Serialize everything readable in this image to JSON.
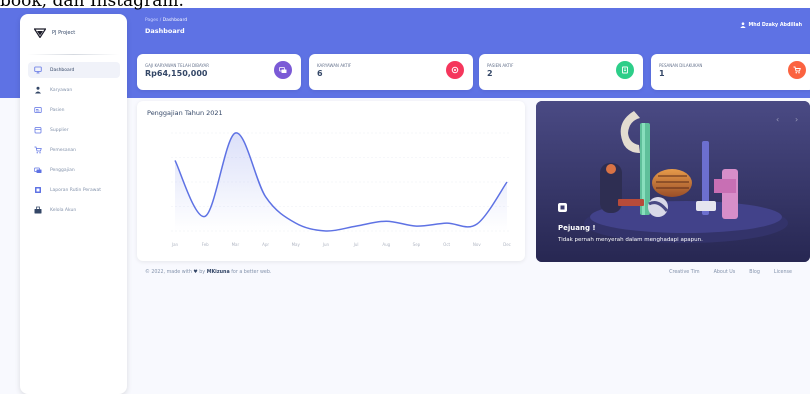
{
  "caption": {
    "text": "book, dan Instagram."
  },
  "sidebar": {
    "brand": "PJ Project",
    "items": [
      {
        "label": "Dashboard",
        "icon": "monitor-icon",
        "color": "#5e72e4",
        "active": true
      },
      {
        "label": "Karyawan",
        "icon": "user-tie-icon",
        "color": "#344767"
      },
      {
        "label": "Pasien",
        "icon": "id-card-icon",
        "color": "#5e72e4"
      },
      {
        "label": "Supplier",
        "icon": "box-icon",
        "color": "#5e72e4"
      },
      {
        "label": "Pemesanan",
        "icon": "cart-icon",
        "color": "#5e72e4"
      },
      {
        "label": "Penggajian",
        "icon": "money-icon",
        "color": "#5e72e4"
      },
      {
        "label": "Laporan Rutin Perawat",
        "icon": "report-icon",
        "color": "#5e72e4"
      },
      {
        "label": "Kelola Akun",
        "icon": "users-icon",
        "color": "#344767"
      }
    ]
  },
  "header": {
    "breadcrumb_root": "Pages",
    "breadcrumb_sep": "/",
    "breadcrumb_current": "Dashboard",
    "title": "Dashboard",
    "user": "Mhd Dzaky Abdillah"
  },
  "stats": [
    {
      "label": "GAJI KARYAWAN TELAH DIBAYAR",
      "value": "Rp64,150,000",
      "icon": "money-icon",
      "color": "#7b5ad6"
    },
    {
      "label": "KARYAWAN AKTIF",
      "value": "6",
      "icon": "circle-icon",
      "color": "#f5365c"
    },
    {
      "label": "PASIEN AKTIF",
      "value": "2",
      "icon": "clipboard-icon",
      "color": "#2dce89"
    },
    {
      "label": "PESANAN DILAKUKAN",
      "value": "1",
      "icon": "cart-icon",
      "color": "#fb6340"
    }
  ],
  "chart_data": {
    "type": "line",
    "title": "Penggajian Tahun 2021",
    "categories": [
      "Jan",
      "Feb",
      "Mar",
      "Apr",
      "May",
      "Jun",
      "Jul",
      "Aug",
      "Sep",
      "Oct",
      "Nov",
      "Dec"
    ],
    "values": [
      72,
      15,
      100,
      35,
      8,
      0,
      5,
      10,
      5,
      8,
      7,
      50
    ],
    "ylim": [
      0,
      100
    ],
    "grid": true,
    "color": "#5e72e4"
  },
  "promo": {
    "title": "Pejuang !",
    "subtitle": "Tidak pernah menyerah dalam menghadapi apapun.",
    "prev": "‹",
    "next": "›"
  },
  "footer": {
    "copyright_pre": "© 2022, made with",
    "copyright_by": "by",
    "copyright_name": "MKizuna",
    "copyright_post": "for a better web.",
    "links": [
      "Creative Tim",
      "About Us",
      "Blog",
      "License"
    ]
  }
}
